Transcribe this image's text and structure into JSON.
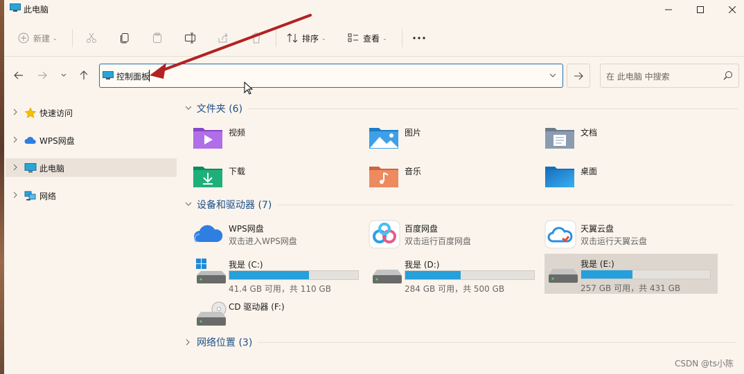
{
  "window": {
    "title": "此电脑"
  },
  "toolbar": {
    "new_label": "新建",
    "sort_label": "排序",
    "view_label": "查看"
  },
  "nav": {
    "path": "控制面板"
  },
  "search": {
    "placeholder": "在 此电脑 中搜索"
  },
  "sidebar": {
    "items": [
      {
        "label": "快速访问",
        "icon": "star-icon"
      },
      {
        "label": "WPS网盘",
        "icon": "cloud-icon"
      },
      {
        "label": "此电脑",
        "icon": "computer-icon",
        "selected": true
      },
      {
        "label": "网络",
        "icon": "network-icon"
      }
    ]
  },
  "sections": {
    "folders": {
      "label": "文件夹 (6)"
    },
    "devices": {
      "label": "设备和驱动器 (7)"
    },
    "network": {
      "label": "网络位置 (3)"
    }
  },
  "folders": [
    {
      "label": "视频",
      "icon": "video-folder-icon"
    },
    {
      "label": "图片",
      "icon": "pictures-folder-icon"
    },
    {
      "label": "文档",
      "icon": "documents-folder-icon"
    },
    {
      "label": "下载",
      "icon": "downloads-folder-icon"
    },
    {
      "label": "音乐",
      "icon": "music-folder-icon"
    },
    {
      "label": "桌面",
      "icon": "desktop-folder-icon"
    }
  ],
  "devices": [
    {
      "name": "WPS网盘",
      "sub": "双击进入WPS网盘",
      "icon": "wps-cloud-icon"
    },
    {
      "name": "百度网盘",
      "sub": "双击运行百度网盘",
      "icon": "baidu-netdisk-icon"
    },
    {
      "name": "天翼云盘",
      "sub": "双击运行天翼云盘",
      "icon": "tianyi-cloud-icon"
    }
  ],
  "drives": [
    {
      "name": "我是 (C:)",
      "sub": "41.4 GB 可用，共 110 GB",
      "used_fraction": 0.62,
      "icon": "windows-drive-icon"
    },
    {
      "name": "我是 (D:)",
      "sub": "284 GB 可用，共 500 GB",
      "used_fraction": 0.43,
      "icon": "drive-icon"
    },
    {
      "name": "我是 (E:)",
      "sub": "257 GB 可用，共 431 GB",
      "used_fraction": 0.4,
      "icon": "drive-icon",
      "selected": true
    }
  ],
  "cd": {
    "name": "CD 驱动器 (F:)",
    "icon": "cd-drive-icon"
  },
  "watermark": "CSDN @ts小陈",
  "colors": {
    "accent": "#1f6fb2",
    "section_text": "#1b4f8a",
    "bar_fill": "#26a0da",
    "annotation_arrow": "#b22222"
  }
}
